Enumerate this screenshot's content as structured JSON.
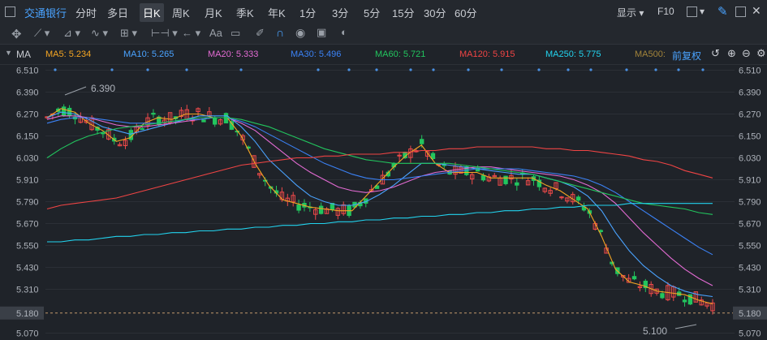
{
  "toolbar": {
    "stock_name": "交通银行",
    "periods": [
      "分时",
      "多日",
      "日K",
      "周K",
      "月K",
      "季K",
      "年K",
      "1分",
      "3分",
      "5分",
      "15分",
      "30分",
      "60分"
    ],
    "active_period": "日K",
    "display_label": "显示",
    "f10_label": "F10",
    "aa_label": "Aa"
  },
  "indicator": {
    "label": "MA",
    "fq_label": "前复权",
    "items": [
      {
        "label": "MA5: 5.234",
        "color": "#f5a623"
      },
      {
        "label": "MA10: 5.265",
        "color": "#4aa3ff"
      },
      {
        "label": "MA20: 5.333",
        "color": "#e36bd3"
      },
      {
        "label": "MA30: 5.496",
        "color": "#3b82f6"
      },
      {
        "label": "MA60: 5.721",
        "color": "#22c55e"
      },
      {
        "label": "MA120: 5.915",
        "color": "#ef4444"
      },
      {
        "label": "MA250: 5.775",
        "color": "#22d3ee"
      },
      {
        "label": "MA500:",
        "color": "#a3843a"
      }
    ]
  },
  "chart_data": {
    "type": "candlestick",
    "y_ticks": [
      "6.510",
      "6.390",
      "6.270",
      "6.150",
      "6.030",
      "5.910",
      "5.790",
      "5.670",
      "5.550",
      "5.430",
      "5.310",
      "5.070"
    ],
    "ylim": [
      5.05,
      6.53
    ],
    "current_price": "5.180",
    "high_label": "6.390",
    "low_label": "5.100",
    "ma_lines": [
      {
        "name": "MA5",
        "color": "#f5a623",
        "y": [
          6.25,
          6.3,
          6.28,
          6.22,
          6.18,
          6.12,
          6.14,
          6.22,
          6.25,
          6.24,
          6.27,
          6.27,
          6.25,
          6.25,
          6.15,
          6.0,
          5.88,
          5.8,
          5.78,
          5.76,
          5.75,
          5.74,
          5.74,
          5.82,
          5.9,
          5.98,
          6.05,
          6.1,
          6.0,
          5.95,
          5.95,
          5.95,
          5.92,
          5.92,
          5.92,
          5.92,
          5.88,
          5.85,
          5.8,
          5.75,
          5.6,
          5.42,
          5.35,
          5.33,
          5.3,
          5.29,
          5.28,
          5.25,
          5.23
        ]
      },
      {
        "name": "MA10",
        "color": "#4aa3ff",
        "y": [
          6.25,
          6.28,
          6.27,
          6.24,
          6.2,
          6.18,
          6.16,
          6.18,
          6.2,
          6.22,
          6.24,
          6.26,
          6.26,
          6.26,
          6.2,
          6.12,
          6.02,
          5.95,
          5.88,
          5.82,
          5.79,
          5.77,
          5.77,
          5.79,
          5.83,
          5.88,
          5.94,
          6.0,
          6.0,
          5.99,
          5.98,
          5.97,
          5.96,
          5.95,
          5.94,
          5.94,
          5.92,
          5.9,
          5.87,
          5.82,
          5.74,
          5.62,
          5.52,
          5.44,
          5.38,
          5.33,
          5.3,
          5.28,
          5.27
        ]
      },
      {
        "name": "MA20",
        "color": "#e36bd3",
        "y": [
          6.24,
          6.26,
          6.26,
          6.25,
          6.23,
          6.21,
          6.2,
          6.2,
          6.21,
          6.22,
          6.23,
          6.24,
          6.25,
          6.25,
          6.22,
          6.18,
          6.12,
          6.06,
          6.0,
          5.95,
          5.91,
          5.87,
          5.85,
          5.84,
          5.85,
          5.87,
          5.9,
          5.93,
          5.95,
          5.96,
          5.97,
          5.98,
          5.98,
          5.97,
          5.96,
          5.95,
          5.94,
          5.93,
          5.91,
          5.88,
          5.84,
          5.78,
          5.7,
          5.62,
          5.55,
          5.48,
          5.42,
          5.37,
          5.33
        ]
      },
      {
        "name": "MA30",
        "color": "#3b82f6",
        "y": [
          6.22,
          6.24,
          6.25,
          6.25,
          6.24,
          6.23,
          6.22,
          6.22,
          6.22,
          6.23,
          6.24,
          6.24,
          6.25,
          6.25,
          6.23,
          6.2,
          6.16,
          6.12,
          6.08,
          6.04,
          6.0,
          5.97,
          5.94,
          5.92,
          5.91,
          5.91,
          5.92,
          5.93,
          5.94,
          5.95,
          5.96,
          5.97,
          5.97,
          5.97,
          5.97,
          5.96,
          5.95,
          5.94,
          5.93,
          5.91,
          5.88,
          5.84,
          5.79,
          5.74,
          5.69,
          5.64,
          5.59,
          5.54,
          5.5
        ]
      },
      {
        "name": "MA60",
        "color": "#22c55e",
        "y": [
          6.03,
          6.08,
          6.12,
          6.15,
          6.17,
          6.19,
          6.2,
          6.21,
          6.22,
          6.23,
          6.24,
          6.25,
          6.25,
          6.25,
          6.24,
          6.22,
          6.2,
          6.17,
          6.14,
          6.11,
          6.08,
          6.06,
          6.04,
          6.02,
          6.01,
          6.0,
          6.0,
          6.0,
          6.0,
          6.0,
          5.99,
          5.98,
          5.97,
          5.96,
          5.95,
          5.94,
          5.92,
          5.9,
          5.88,
          5.86,
          5.84,
          5.82,
          5.8,
          5.78,
          5.77,
          5.76,
          5.75,
          5.73,
          5.72
        ]
      },
      {
        "name": "MA120",
        "color": "#ef4444",
        "y": [
          5.75,
          5.77,
          5.78,
          5.79,
          5.8,
          5.81,
          5.83,
          5.85,
          5.87,
          5.89,
          5.91,
          5.93,
          5.95,
          5.97,
          5.99,
          6.0,
          6.01,
          6.02,
          6.03,
          6.03,
          6.04,
          6.04,
          6.05,
          6.05,
          6.05,
          6.06,
          6.06,
          6.07,
          6.07,
          6.08,
          6.08,
          6.09,
          6.09,
          6.09,
          6.09,
          6.09,
          6.08,
          6.08,
          6.07,
          6.07,
          6.06,
          6.05,
          6.04,
          6.02,
          6.01,
          5.99,
          5.96,
          5.94,
          5.92
        ]
      },
      {
        "name": "MA250",
        "color": "#22d3ee",
        "y": [
          5.57,
          5.57,
          5.58,
          5.58,
          5.59,
          5.6,
          5.6,
          5.61,
          5.61,
          5.62,
          5.62,
          5.63,
          5.63,
          5.64,
          5.64,
          5.65,
          5.65,
          5.66,
          5.66,
          5.67,
          5.67,
          5.68,
          5.68,
          5.69,
          5.69,
          5.7,
          5.7,
          5.71,
          5.71,
          5.72,
          5.72,
          5.73,
          5.73,
          5.74,
          5.74,
          5.75,
          5.75,
          5.76,
          5.76,
          5.77,
          5.77,
          5.77,
          5.78,
          5.78,
          5.78,
          5.78,
          5.78,
          5.78,
          5.78
        ]
      }
    ]
  }
}
